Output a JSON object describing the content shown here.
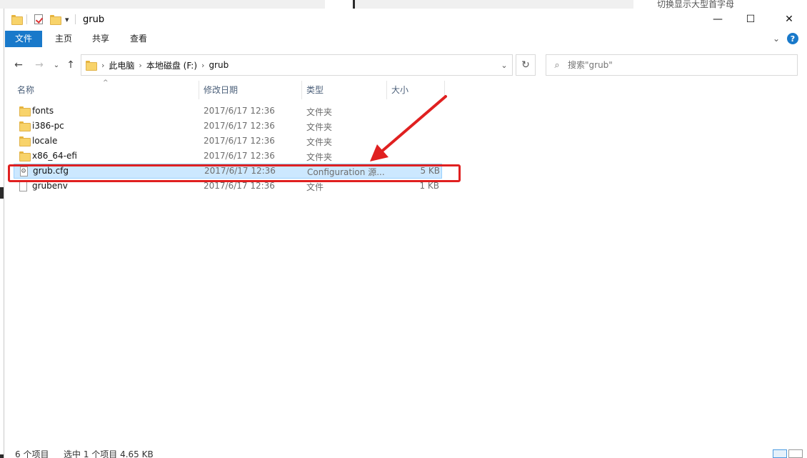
{
  "background": {
    "hint_text": "切换显示大型首字母"
  },
  "titlebar": {
    "title": "grub",
    "qa_dropdown_glyph": "▾",
    "minimize_glyph": "—",
    "maximize_glyph": "☐",
    "close_glyph": "✕"
  },
  "ribbon": {
    "tabs": [
      {
        "label": "文件"
      },
      {
        "label": "主页"
      },
      {
        "label": "共享"
      },
      {
        "label": "查看"
      }
    ],
    "expand_glyph": "⌄",
    "help_glyph": "?"
  },
  "navigation": {
    "back_glyph": "←",
    "forward_glyph": "→",
    "recent_glyph": "⌄",
    "up_glyph": "↑",
    "breadcrumbs": [
      "此电脑",
      "本地磁盘 (F:)",
      "grub"
    ],
    "crumb_separator": "›",
    "dropdown_glyph": "⌄",
    "refresh_glyph": "↻",
    "search_glyph": "⌕",
    "search_placeholder": "搜索\"grub\""
  },
  "columns": {
    "name": "名称",
    "date": "修改日期",
    "type": "类型",
    "size": "大小",
    "sort_glyph": "^"
  },
  "files": [
    {
      "name": "fonts",
      "date": "2017/6/17 12:36",
      "type": "文件夹",
      "size": "",
      "kind": "folder"
    },
    {
      "name": "i386-pc",
      "date": "2017/6/17 12:36",
      "type": "文件夹",
      "size": "",
      "kind": "folder"
    },
    {
      "name": "locale",
      "date": "2017/6/17 12:36",
      "type": "文件夹",
      "size": "",
      "kind": "folder"
    },
    {
      "name": "x86_64-efi",
      "date": "2017/6/17 12:36",
      "type": "文件夹",
      "size": "",
      "kind": "folder"
    },
    {
      "name": "grub.cfg",
      "date": "2017/6/17 12:36",
      "type": "Configuration 源...",
      "size": "5 KB",
      "kind": "config",
      "selected": true
    },
    {
      "name": "grubenv",
      "date": "2017/6/17 12:36",
      "type": "文件",
      "size": "1 KB",
      "kind": "file"
    }
  ],
  "status": {
    "item_count": "6 个项目",
    "selection": "选中 1 个项目  4.65 KB"
  },
  "colors": {
    "accent": "#1979ca",
    "selection_bg": "#cce8ff",
    "annotation_red": "#e02020"
  }
}
